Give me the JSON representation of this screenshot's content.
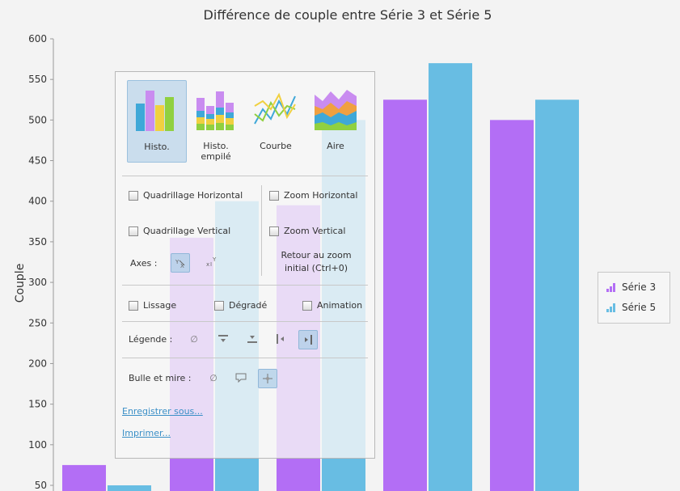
{
  "chart_data": {
    "type": "bar",
    "title": "Différence de couple entre Série 3 et Série 5",
    "ylabel": "Couple",
    "ylim": [
      30,
      610
    ],
    "y_ticks": [
      "50",
      "100",
      "150",
      "200",
      "250",
      "300",
      "350",
      "400",
      "450",
      "500",
      "550",
      "600"
    ],
    "series": [
      {
        "name": "Série 3",
        "color": "#b36ef5",
        "values": [
          75,
          355,
          395,
          525,
          500
        ]
      },
      {
        "name": "Série 5",
        "color": "#68bde3",
        "values": [
          50,
          400,
          500,
          570,
          525
        ]
      }
    ],
    "legend_position": "right",
    "grid": false
  },
  "panel": {
    "chart_types": [
      "Histo.",
      "Histo. empilé",
      "Courbe",
      "Aire"
    ],
    "selected_type": "Histo.",
    "grid_h": "Quadrillage Horizontal",
    "grid_v": "Quadrillage Vertical",
    "zoom_h": "Zoom Horizontal",
    "zoom_v": "Zoom Vertical",
    "reset_zoom_1": "Retour au zoom",
    "reset_zoom_2": "initial (Ctrl+0)",
    "axes": "Axes :",
    "smooth": "Lissage",
    "gradient": "Dégradé",
    "animation": "Animation",
    "legend": "Légende :",
    "tooltip": "Bulle et mire :",
    "save_as": "Enregistrer sous...",
    "print": "Imprimer..."
  }
}
